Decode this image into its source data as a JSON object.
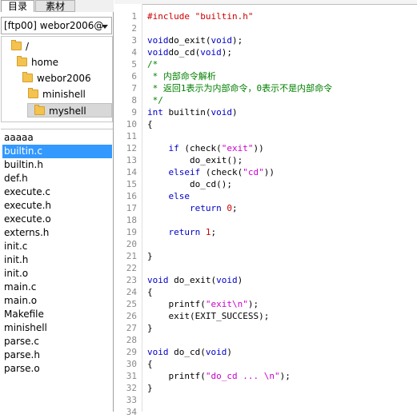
{
  "tabs": {
    "active_label": "目录",
    "inactive_label": "素材"
  },
  "server_select": {
    "value": "[ftp00] webor2006@"
  },
  "tree": [
    {
      "label": "/",
      "depth": 0
    },
    {
      "label": "home",
      "depth": 1
    },
    {
      "label": "webor2006",
      "depth": 2
    },
    {
      "label": "minishell",
      "depth": 3
    },
    {
      "label": "myshell",
      "depth": 4,
      "selected": true
    }
  ],
  "files": {
    "items": [
      "aaaaa",
      "builtin.c",
      "builtin.h",
      "def.h",
      "execute.c",
      "execute.h",
      "execute.o",
      "externs.h",
      "init.c",
      "init.h",
      "init.o",
      "main.c",
      "main.o",
      "Makefile",
      "minishell",
      "parse.c",
      "parse.h",
      "parse.o"
    ],
    "selected": "builtin.c"
  },
  "colors": {
    "selection": "#3399ff",
    "keyword": "#0000cc",
    "string": "#cc00cc",
    "comment": "#008000",
    "preprocessor": "#cc0000",
    "number": "#cc0000"
  },
  "editor": {
    "line_numbers": [
      "1",
      "2",
      "3",
      "4",
      "5",
      "6",
      "7",
      "8",
      "9",
      "10",
      "11",
      "12",
      "13",
      "14",
      "15",
      "16",
      "17",
      "18",
      "19",
      "20",
      "21",
      "22",
      "23",
      "24",
      "25",
      "26",
      "27",
      "28",
      "29",
      "30",
      "31",
      "32",
      "33",
      "34"
    ],
    "lines": [
      [
        [
          "pre",
          "#include \"builtin.h\""
        ]
      ],
      [],
      [
        [
          "kw",
          "void"
        ],
        [
          "",
          "do_exit("
        ],
        [
          "kw",
          "void"
        ],
        [
          "",
          ");"
        ]
      ],
      [
        [
          "kw",
          "void"
        ],
        [
          "",
          "do_cd("
        ],
        [
          "kw",
          "void"
        ],
        [
          "",
          ");"
        ]
      ],
      [
        [
          "cmt",
          "/*"
        ]
      ],
      [
        [
          "cmt",
          " * 内部命令解析"
        ]
      ],
      [
        [
          "cmt",
          " * 返回1表示为内部命令，0表示不是内部命令"
        ]
      ],
      [
        [
          "cmt",
          " */"
        ]
      ],
      [
        [
          "kw",
          "int"
        ],
        [
          "",
          " builtin("
        ],
        [
          "kw",
          "void"
        ],
        [
          "",
          ")"
        ]
      ],
      [
        [
          "",
          "{"
        ]
      ],
      [],
      [
        [
          "",
          "    "
        ],
        [
          "kw",
          "if"
        ],
        [
          "",
          " (check("
        ],
        [
          "str",
          "\"exit\""
        ],
        [
          "",
          "))"
        ]
      ],
      [
        [
          "",
          "        do_exit();"
        ]
      ],
      [
        [
          "",
          "    "
        ],
        [
          "kw",
          "else"
        ],
        [
          "",
          "",
          " "
        ],
        [
          "kw",
          "if"
        ],
        [
          "",
          " (check("
        ],
        [
          "str",
          "\"cd\""
        ],
        [
          "",
          "))"
        ]
      ],
      [
        [
          "",
          "        do_cd();"
        ]
      ],
      [
        [
          "",
          "    "
        ],
        [
          "kw",
          "else"
        ]
      ],
      [
        [
          "",
          "        "
        ],
        [
          "kw",
          "return"
        ],
        [
          "",
          " "
        ],
        [
          "num",
          "0"
        ],
        [
          "",
          ";"
        ]
      ],
      [],
      [
        [
          "",
          "    "
        ],
        [
          "kw",
          "return"
        ],
        [
          "",
          " "
        ],
        [
          "num",
          "1"
        ],
        [
          "",
          ";"
        ]
      ],
      [],
      [
        [
          "",
          "}"
        ]
      ],
      [],
      [
        [
          "kw",
          "void"
        ],
        [
          "",
          " do_exit("
        ],
        [
          "kw",
          "void"
        ],
        [
          "",
          ")"
        ]
      ],
      [
        [
          "",
          "{"
        ]
      ],
      [
        [
          "",
          "    printf("
        ],
        [
          "str",
          "\"exit\\n\""
        ],
        [
          "",
          ");"
        ]
      ],
      [
        [
          "",
          "    exit(EXIT_SUCCESS);"
        ]
      ],
      [
        [
          "",
          "}"
        ]
      ],
      [],
      [
        [
          "kw",
          "void"
        ],
        [
          "",
          " do_cd("
        ],
        [
          "kw",
          "void"
        ],
        [
          "",
          ")"
        ]
      ],
      [
        [
          "",
          "{"
        ]
      ],
      [
        [
          "",
          "    printf("
        ],
        [
          "str",
          "\"do_cd ... \\n\""
        ],
        [
          "",
          ");"
        ]
      ],
      [
        [
          "",
          "}"
        ]
      ],
      [],
      []
    ]
  }
}
